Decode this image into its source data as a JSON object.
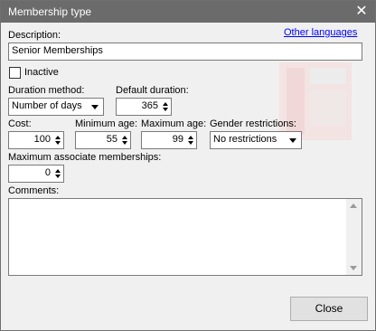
{
  "window": {
    "title": "Membership type",
    "close_glyph": "✕"
  },
  "links": {
    "other_languages": "Other languages"
  },
  "description": {
    "label": "Description:",
    "value": "Senior Memberships"
  },
  "inactive": {
    "label": "Inactive",
    "checked": false
  },
  "duration_method": {
    "label": "Duration method:",
    "value": "Number of days"
  },
  "default_duration": {
    "label": "Default duration:",
    "value": "365"
  },
  "cost": {
    "label": "Cost:",
    "value": "100"
  },
  "minimum_age": {
    "label": "Minimum age:",
    "value": "55"
  },
  "maximum_age": {
    "label": "Maximum age:",
    "value": "99"
  },
  "gender_restrictions": {
    "label": "Gender restrictions:",
    "value": "No restrictions"
  },
  "max_associate": {
    "label": "Maximum associate memberships:",
    "value": "0"
  },
  "comments": {
    "label": "Comments:",
    "value": ""
  },
  "buttons": {
    "close": "Close"
  },
  "icons": {
    "close_window": "close-icon",
    "dropdown": "chevron-down-icon",
    "spin": "spinner-arrows-icon"
  }
}
